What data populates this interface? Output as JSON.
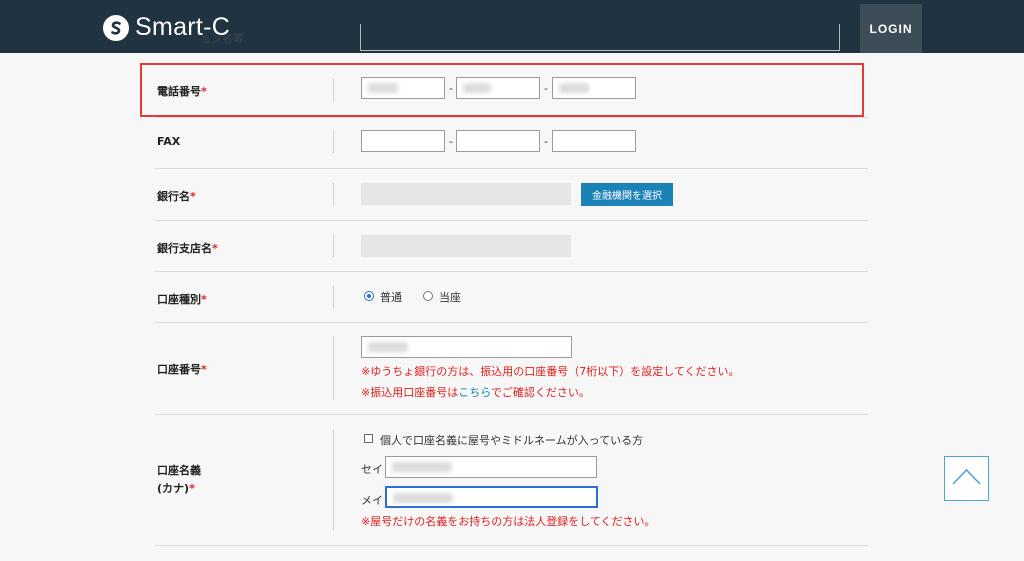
{
  "header": {
    "brand": "Smart-C",
    "login_label": "LOGIN",
    "ghost_label": "ョン名等"
  },
  "form": {
    "phone": {
      "label": "電話番号",
      "required": "*",
      "sep1": "-",
      "sep2": "-"
    },
    "fax": {
      "label": "FAX",
      "sep1": "-",
      "sep2": "-"
    },
    "bank": {
      "label": "銀行名",
      "required": "*",
      "select_button": "金融機関を選択"
    },
    "branch": {
      "label": "銀行支店名",
      "required": "*"
    },
    "account_type": {
      "label": "口座種別",
      "required": "*",
      "options": [
        {
          "label": "普通",
          "checked": true
        },
        {
          "label": "当座",
          "checked": false
        }
      ]
    },
    "account_number": {
      "label": "口座番号",
      "required": "*",
      "note1": "※ゆうちょ銀行の方は、振込用の口座番号（7桁以下）を設定してください。",
      "note2_prefix": "※振込用口座番号は",
      "note2_link": "こちら",
      "note2_suffix": "でご確認ください。"
    },
    "account_name": {
      "label_line1": "口座名義",
      "label_line2": "(カナ)",
      "required": "*",
      "checkbox_label": "個人で口座名義に屋号やミドルネームが入っている方",
      "sei_label": "セイ",
      "mei_label": "メイ",
      "note": "※屋号だけの名義をお持ちの方は法人登録をしてください。"
    }
  },
  "colors": {
    "header_bg": "#1f3340",
    "accent_blue": "#1b82b8",
    "required_red": "#e0201e",
    "highlight_red": "#e53935"
  }
}
